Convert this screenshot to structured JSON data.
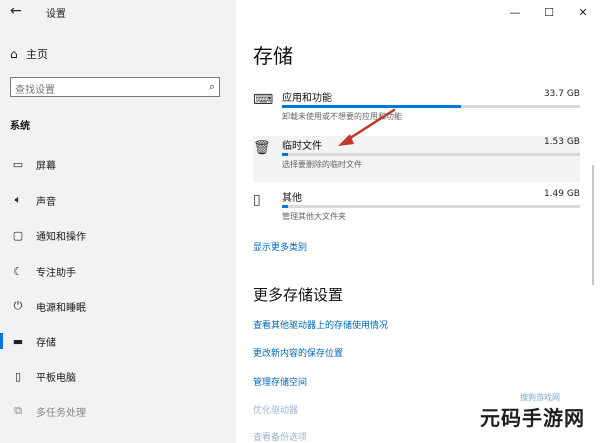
{
  "window": {
    "title": "设置",
    "back_icon": "←",
    "minimize": "—",
    "maximize": "☐",
    "close": "✕"
  },
  "sidebar": {
    "home_label": "主页",
    "search_placeholder": "查找设置",
    "section_title": "系统",
    "items": [
      {
        "label": "屏幕",
        "icon": "monitor-icon"
      },
      {
        "label": "声音",
        "icon": "speaker-icon"
      },
      {
        "label": "通知和操作",
        "icon": "notification-icon"
      },
      {
        "label": "专注助手",
        "icon": "moon-icon"
      },
      {
        "label": "电源和睡眠",
        "icon": "power-icon"
      },
      {
        "label": "存储",
        "icon": "storage-icon",
        "active": true
      },
      {
        "label": "平板电脑",
        "icon": "tablet-icon"
      },
      {
        "label": "多任务处理",
        "icon": "multitask-icon"
      }
    ]
  },
  "main": {
    "title": "存储",
    "categories": [
      {
        "name": "应用和功能",
        "size": "33.7 GB",
        "desc": "卸载未使用或不想要的应用和功能",
        "usage": 0.6
      },
      {
        "name": "临时文件",
        "size": "1.53 GB",
        "desc": "选择要删除的临时文件",
        "usage": 0.02
      },
      {
        "name": "其他",
        "size": "1.49 GB",
        "desc": "管理其他大文件夹",
        "usage": 0.02
      }
    ],
    "show_more": "显示更多类别",
    "more_settings_title": "更多存储设置",
    "links": [
      "查看其他驱动器上的存储使用情况",
      "更改新内容的保存位置",
      "管理存储空间",
      "优化驱动器",
      "查看备份选项"
    ]
  },
  "watermark": {
    "text": "元码手游网",
    "sub": "搜狗游戏网"
  },
  "colors": {
    "accent": "#0078d7",
    "link": "#0067b8",
    "sidebar_bg": "#f2f2f2",
    "arrow": "#c0392b"
  }
}
